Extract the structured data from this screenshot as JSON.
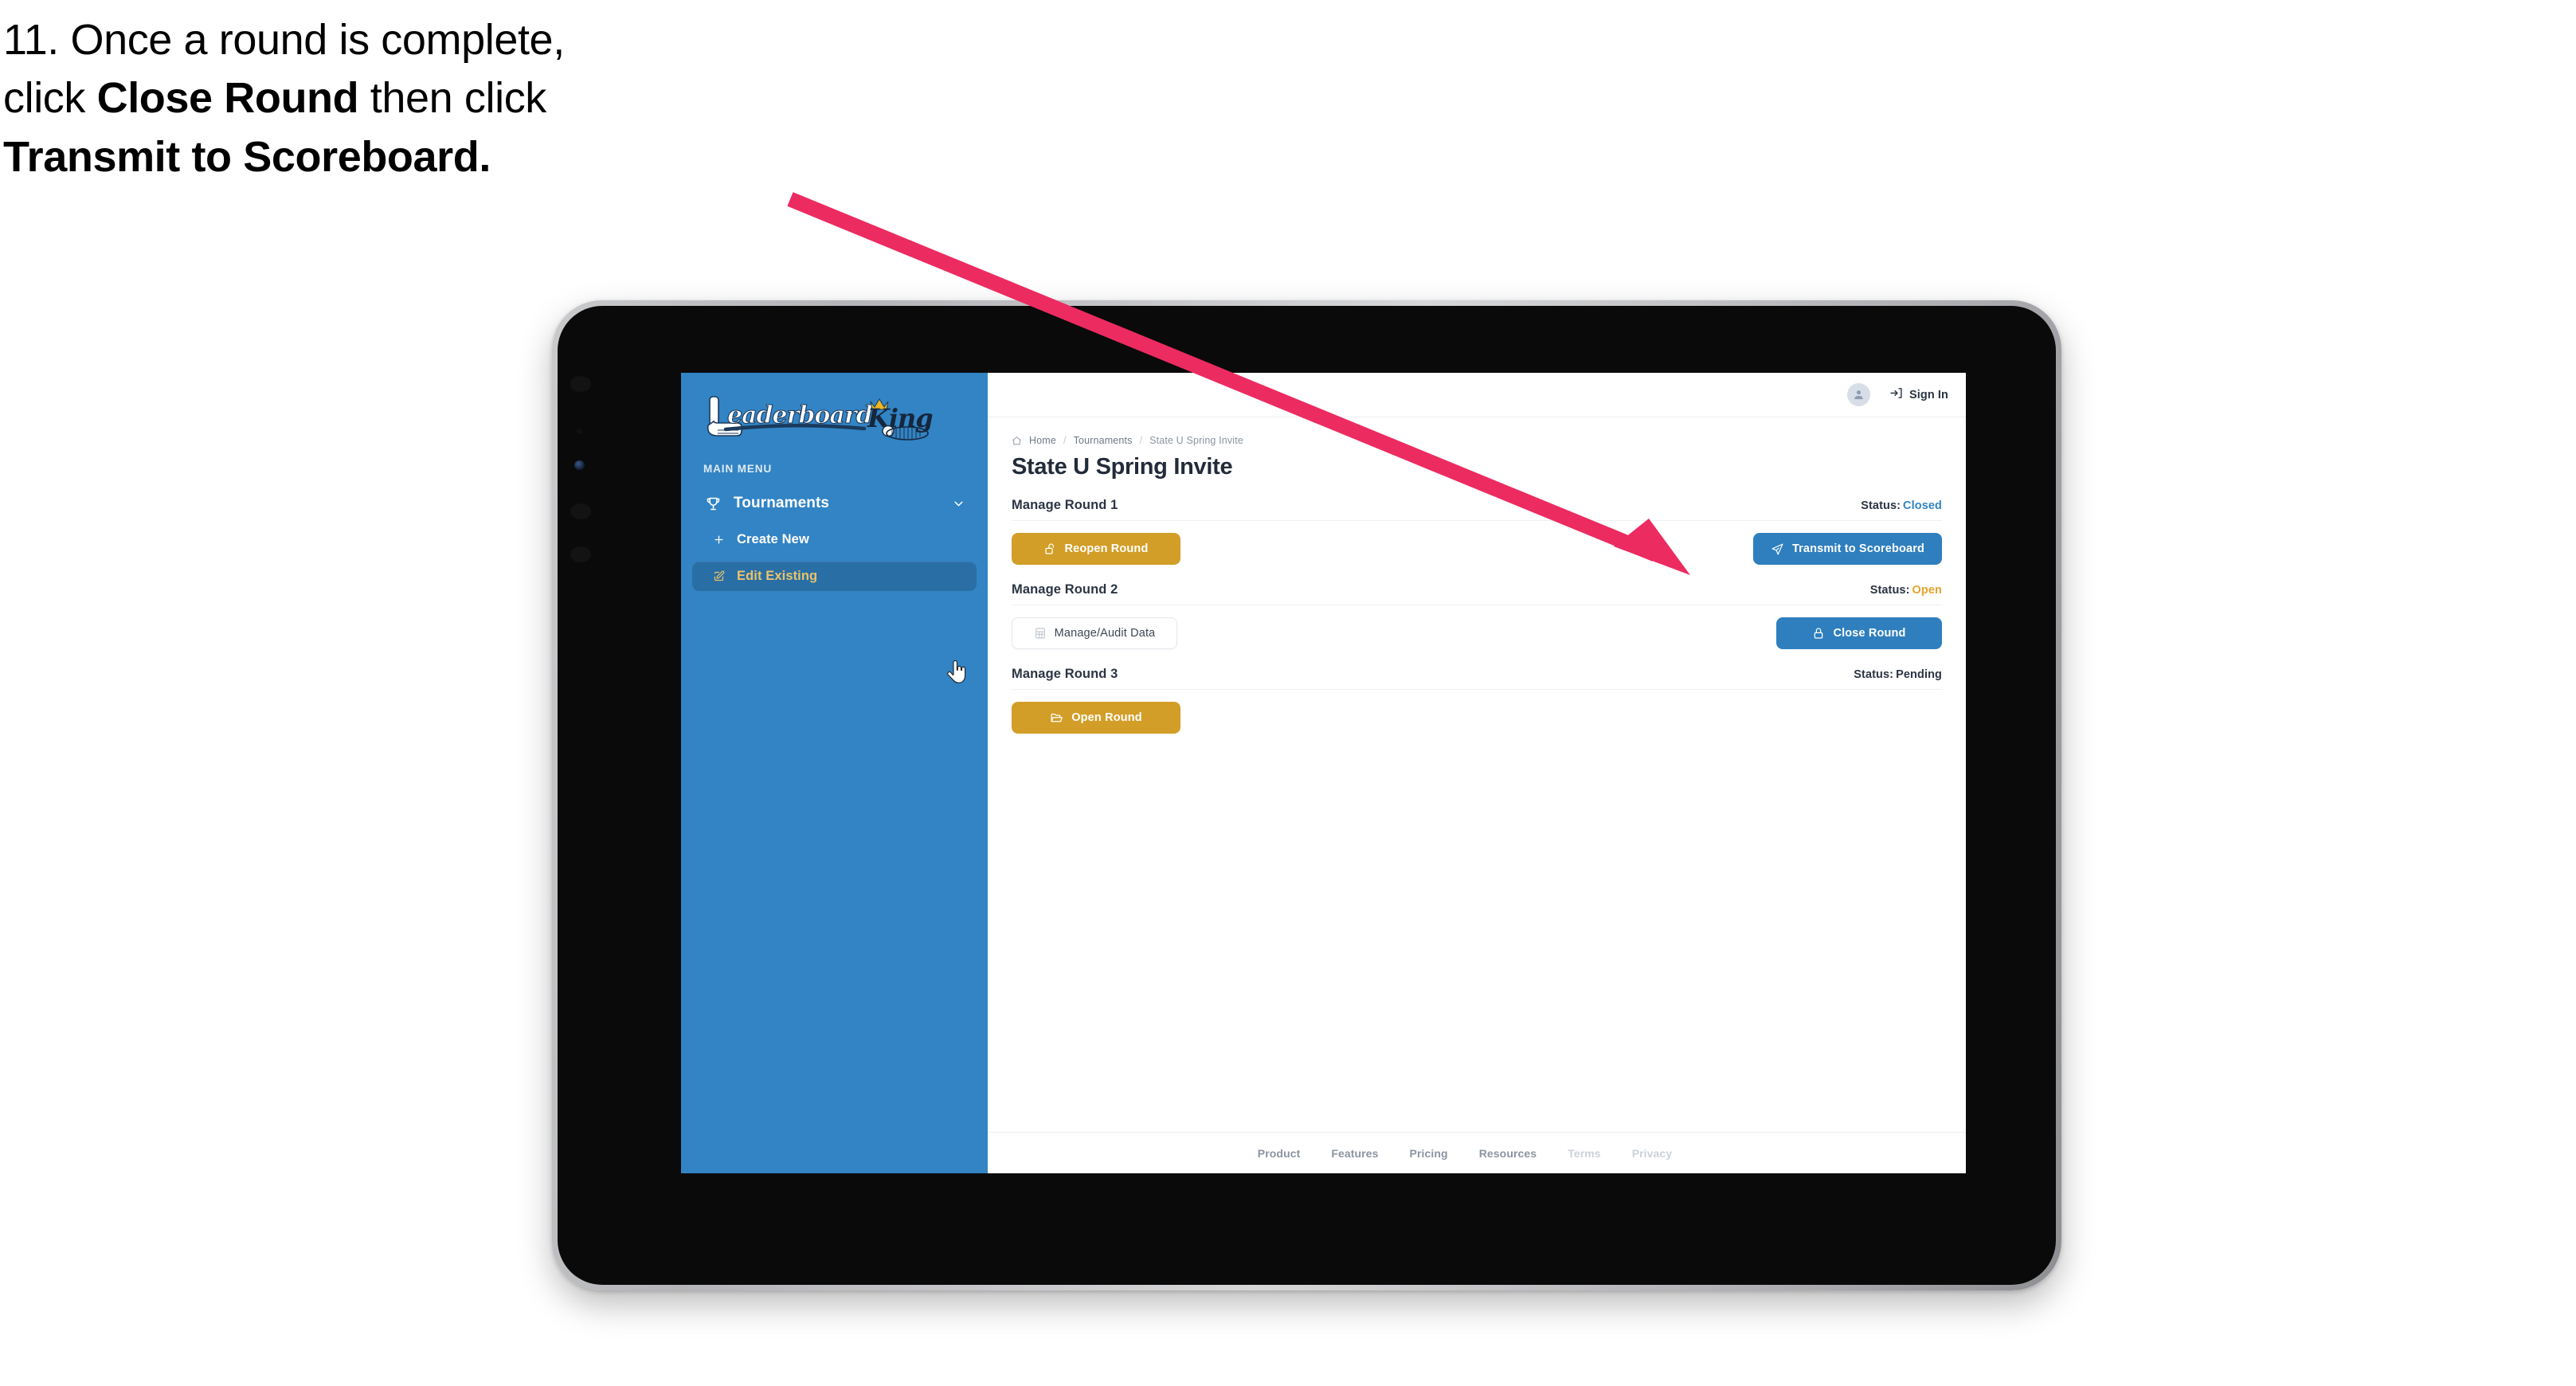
{
  "caption": {
    "line1_plain": "11. Once a round is complete,",
    "line2_pre": "click ",
    "line2_bold": "Close Round",
    "line2_post": " then click",
    "line3_bold": "Transmit to Scoreboard."
  },
  "annotation": {
    "arrow_color": "#ec2b61",
    "points_at": "Transmit to Scoreboard"
  },
  "app": {
    "logo_word_one": "Leaderboard",
    "logo_word_two": "King"
  },
  "sidebar": {
    "section_label": "MAIN MENU",
    "items": [
      {
        "label": "Tournaments",
        "icon": "trophy-icon",
        "chevron": "chevron-down-icon",
        "level": "top"
      },
      {
        "label": "Create New",
        "icon": "plus-icon",
        "level": "sub",
        "active": false
      },
      {
        "label": "Edit Existing",
        "icon": "edit-square-icon",
        "level": "sub",
        "active": true
      }
    ]
  },
  "topbar": {
    "avatar_icon": "user-avatar-icon",
    "signin_label": "Sign In",
    "signin_icon": "sign-in-icon"
  },
  "breadcrumb": {
    "home_icon": "home-icon",
    "items": [
      "Home",
      "Tournaments",
      "State U Spring Invite"
    ],
    "separator": "/"
  },
  "page": {
    "title": "State U Spring Invite"
  },
  "rounds": [
    {
      "title": "Manage Round 1",
      "status_label": "Status:",
      "status_value": "Closed",
      "status_class": "closed",
      "left_button": {
        "label": "Reopen Round",
        "icon": "unlock-icon",
        "style": "amber"
      },
      "right_button": {
        "label": "Transmit to Scoreboard",
        "icon": "paper-plane-icon",
        "style": "blue"
      }
    },
    {
      "title": "Manage Round 2",
      "status_label": "Status:",
      "status_value": "Open",
      "status_class": "open",
      "left_button": {
        "label": "Manage/Audit Data",
        "icon": "table-grid-icon",
        "style": "ghost"
      },
      "right_button": {
        "label": "Close Round",
        "icon": "lock-icon",
        "style": "blue"
      }
    },
    {
      "title": "Manage Round 3",
      "status_label": "Status:",
      "status_value": "Pending",
      "status_class": "pending",
      "left_button": {
        "label": "Open Round",
        "icon": "folder-open-icon",
        "style": "amber"
      },
      "right_button": null
    }
  ],
  "footer": {
    "links": [
      {
        "label": "Product",
        "muted": false
      },
      {
        "label": "Features",
        "muted": false
      },
      {
        "label": "Pricing",
        "muted": false
      },
      {
        "label": "Resources",
        "muted": false
      },
      {
        "label": "Terms",
        "muted": true
      },
      {
        "label": "Privacy",
        "muted": true
      }
    ]
  },
  "colors": {
    "sidebar_blue": "#3284c4",
    "sidebar_active": "#2a6ea6",
    "accent_gold": "#e8c46a",
    "button_amber": "#d39e27",
    "button_blue": "#2f7fbe",
    "status_open": "#e0a42b",
    "status_closed": "#3284c4",
    "arrow_pink": "#ec2b61",
    "text_dark": "#2b3442"
  }
}
